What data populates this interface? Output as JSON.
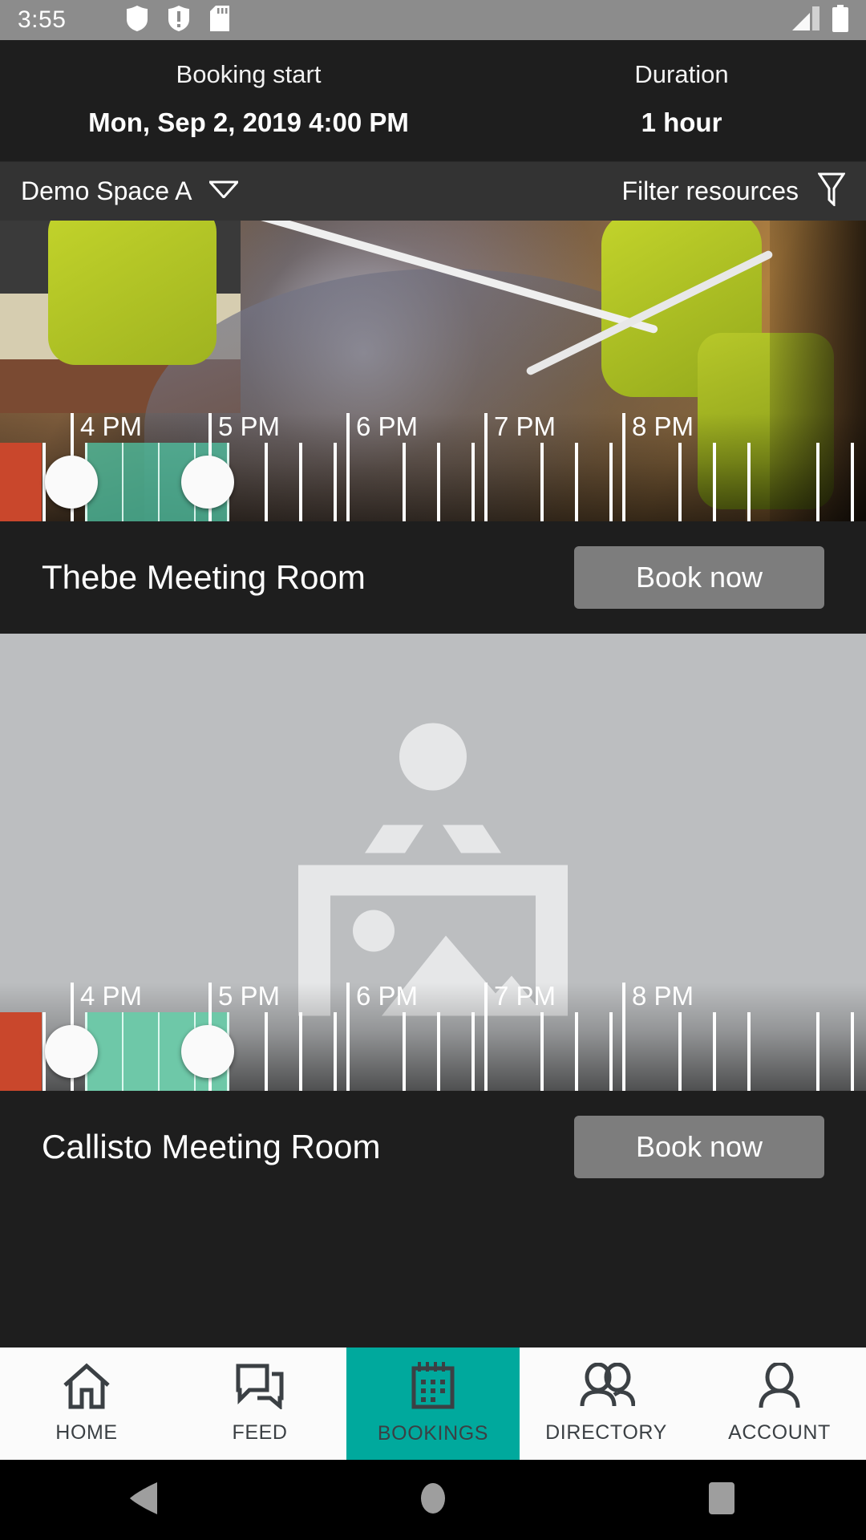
{
  "status_bar": {
    "time": "3:55",
    "icons": [
      "shield-icon",
      "exclamation-icon",
      "sd-card-icon"
    ],
    "right_icons": [
      "signal-icon",
      "battery-icon"
    ],
    "background": "#8c8c8c"
  },
  "booking_header": {
    "start_label": "Booking start",
    "start_value": "Mon, Sep 2, 2019 4:00 PM",
    "duration_label": "Duration",
    "duration_value": "1 hour"
  },
  "filter_bar": {
    "space_name": "Demo Space A",
    "dropdown_icon": "chevron-down-icon",
    "filter_label": "Filter resources",
    "filter_icon": "funnel-icon"
  },
  "timeline": {
    "hour_labels": [
      "4 PM",
      "5 PM",
      "6 PM",
      "7 PM",
      "8 PM"
    ],
    "selection_start": "4 PM",
    "selection_end": "5 PM",
    "past_color": "#c9472c",
    "selection_color": "#6ec8a8",
    "quarter_ticks_per_hour": 4
  },
  "cards": [
    {
      "room_name": "Thebe Meeting Room",
      "book_label": "Book now",
      "media": "photo"
    },
    {
      "room_name": "Callisto Meeting Room",
      "book_label": "Book now",
      "media": "placeholder"
    }
  ],
  "bottom_nav": {
    "active_color": "#00A99D",
    "items": [
      {
        "label": "HOME",
        "icon": "home-icon",
        "active": false
      },
      {
        "label": "FEED",
        "icon": "chat-icon",
        "active": false
      },
      {
        "label": "BOOKINGS",
        "icon": "calendar-icon",
        "active": true
      },
      {
        "label": "DIRECTORY",
        "icon": "people-icon",
        "active": false
      },
      {
        "label": "ACCOUNT",
        "icon": "person-icon",
        "active": false
      }
    ]
  },
  "system_nav": {
    "back": "back-triangle-icon",
    "home": "home-circle-icon",
    "recents": "recents-square-icon"
  },
  "chart_data": {
    "type": "table",
    "title": "Resource availability timeline",
    "categories": [
      "4 PM",
      "5 PM",
      "6 PM",
      "7 PM",
      "8 PM"
    ],
    "series": [
      {
        "name": "Thebe Meeting Room",
        "selected_range": [
          "4:00 PM",
          "5:00 PM"
        ],
        "past_blocked": true
      },
      {
        "name": "Callisto Meeting Room",
        "selected_range": [
          "4:00 PM",
          "5:00 PM"
        ],
        "past_blocked": true
      }
    ]
  }
}
